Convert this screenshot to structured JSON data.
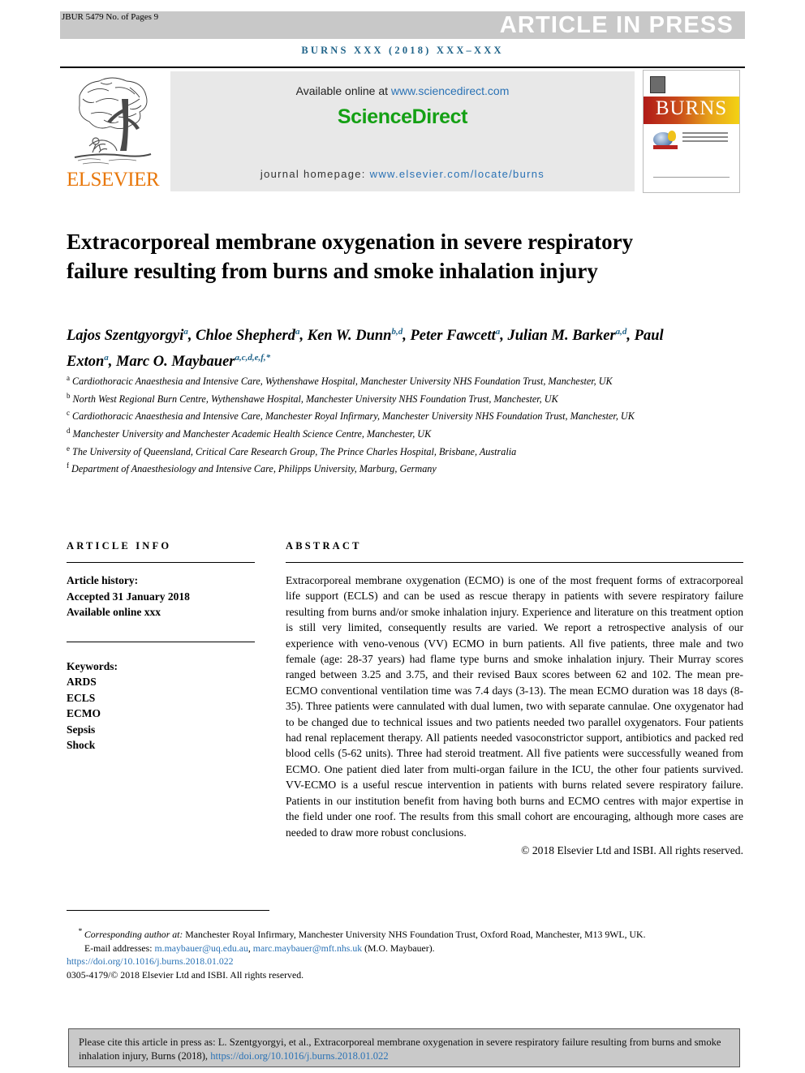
{
  "header": {
    "jbur_line": "JBUR 5479 No. of Pages 9",
    "press_banner": "ARTICLE IN PRESS",
    "journal_ref": "BURNS XXX (2018) XXX–XXX"
  },
  "banner": {
    "publisher": "ELSEVIER",
    "available_prefix": "Available online at ",
    "available_url": "www.sciencedirect.com",
    "sciencedirect_logo": "ScienceDirect",
    "homepage_prefix": "journal homepage: ",
    "homepage_url": "www.elsevier.com/locate/burns",
    "cover_title": "BURNS"
  },
  "article": {
    "title": "Extracorporeal membrane oxygenation in severe respiratory failure resulting from burns and smoke inhalation injury",
    "authors_line1_prefix": "Lajos Szentgyorgyi",
    "authors": [
      {
        "name": "Lajos Szentgyorgyi",
        "sup": "a"
      },
      {
        "name": "Chloe Shepherd",
        "sup": "a"
      },
      {
        "name": "Ken W. Dunn",
        "sup": "b,d"
      },
      {
        "name": "Peter Fawcett",
        "sup": "a"
      },
      {
        "name": "Julian M. Barker",
        "sup": "a,d"
      },
      {
        "name": "Paul Exton",
        "sup": "a"
      },
      {
        "name": "Marc O. Maybauer",
        "sup": "a,c,d,e,f,*"
      }
    ],
    "affiliations": [
      {
        "marker": "a",
        "text": "Cardiothoracic Anaesthesia and Intensive Care, Wythenshawe Hospital, Manchester University NHS Foundation Trust, Manchester, UK"
      },
      {
        "marker": "b",
        "text": "North West Regional Burn Centre, Wythenshawe Hospital, Manchester University NHS Foundation Trust, Manchester, UK"
      },
      {
        "marker": "c",
        "text": "Cardiothoracic Anaesthesia and Intensive Care, Manchester Royal Infirmary, Manchester University NHS Foundation Trust, Manchester, UK"
      },
      {
        "marker": "d",
        "text": "Manchester University and Manchester Academic Health Science Centre, Manchester, UK"
      },
      {
        "marker": "e",
        "text": "The University of Queensland, Critical Care Research Group, The Prince Charles Hospital, Brisbane, Australia"
      },
      {
        "marker": "f",
        "text": "Department of Anaesthesiology and Intensive Care, Philipps University, Marburg, Germany"
      }
    ]
  },
  "article_info": {
    "heading": "ARTICLE INFO",
    "history_label": "Article history:",
    "accepted": "Accepted 31 January 2018",
    "available_online": "Available online xxx",
    "keywords_label": "Keywords:",
    "keywords": [
      "ARDS",
      "ECLS",
      "ECMO",
      "Sepsis",
      "Shock"
    ]
  },
  "abstract": {
    "heading": "ABSTRACT",
    "body": "Extracorporeal membrane oxygenation (ECMO) is one of the most frequent forms of extracorporeal life support (ECLS) and can be used as rescue therapy in patients with severe respiratory failure resulting from burns and/or smoke inhalation injury. Experience and literature on this treatment option is still very limited, consequently results are varied. We report a retrospective analysis of our experience with veno-venous (VV) ECMO in burn patients. All five patients, three male and two female (age: 28-37 years) had flame type burns and smoke inhalation injury. Their Murray scores ranged between 3.25 and 3.75, and their revised Baux scores between 62 and 102. The mean pre-ECMO conventional ventilation time was 7.4 days (3-13). The mean ECMO duration was 18 days (8-35). Three patients were cannulated with dual lumen, two with separate cannulae. One oxygenator had to be changed due to technical issues and two patients needed two parallel oxygenators. Four patients had renal replacement therapy. All patients needed vasoconstrictor support, antibiotics and packed red blood cells (5-62 units). Three had steroid treatment. All five patients were successfully weaned from ECMO. One patient died later from multi-organ failure in the ICU, the other four patients survived. VV-ECMO is a useful rescue intervention in patients with burns related severe respiratory failure. Patients in our institution benefit from having both burns and ECMO centres with major expertise in the field under one roof. The results from this small cohort are encouraging, although more cases are needed to draw more robust conclusions.",
    "copyright": "© 2018 Elsevier Ltd and ISBI. All rights reserved."
  },
  "footnotes": {
    "corresponding_marker": "*",
    "corresponding_lead": "Corresponding author at:",
    "corresponding_text": " Manchester Royal Infirmary, Manchester University NHS Foundation Trust, Oxford Road, Manchester, M13 9WL, UK.",
    "email_label": "E-mail addresses:",
    "email_1": "m.maybauer@uq.edu.au",
    "email_2": "marc.maybauer@mft.nhs.uk",
    "email_attribution": "(M.O. Maybauer).",
    "doi": "https://doi.org/10.1016/j.burns.2018.01.022",
    "issn_line": "0305-4179/© 2018 Elsevier Ltd and ISBI. All rights reserved."
  },
  "cite_box": {
    "text_before": "Please cite this article in press as: L. Szentgyorgyi, et al., Extracorporeal membrane oxygenation in severe respiratory failure resulting from burns and smoke inhalation injury, Burns (2018), ",
    "doi_link": "https://doi.org/10.1016/j.burns.2018.01.022"
  },
  "colors": {
    "journal_blue": "#1f6389",
    "link_blue": "#2a72b5",
    "sciencedirect_green": "#14a014",
    "elsevier_orange": "#e8770a",
    "band_gray": "#c8c8c8"
  }
}
